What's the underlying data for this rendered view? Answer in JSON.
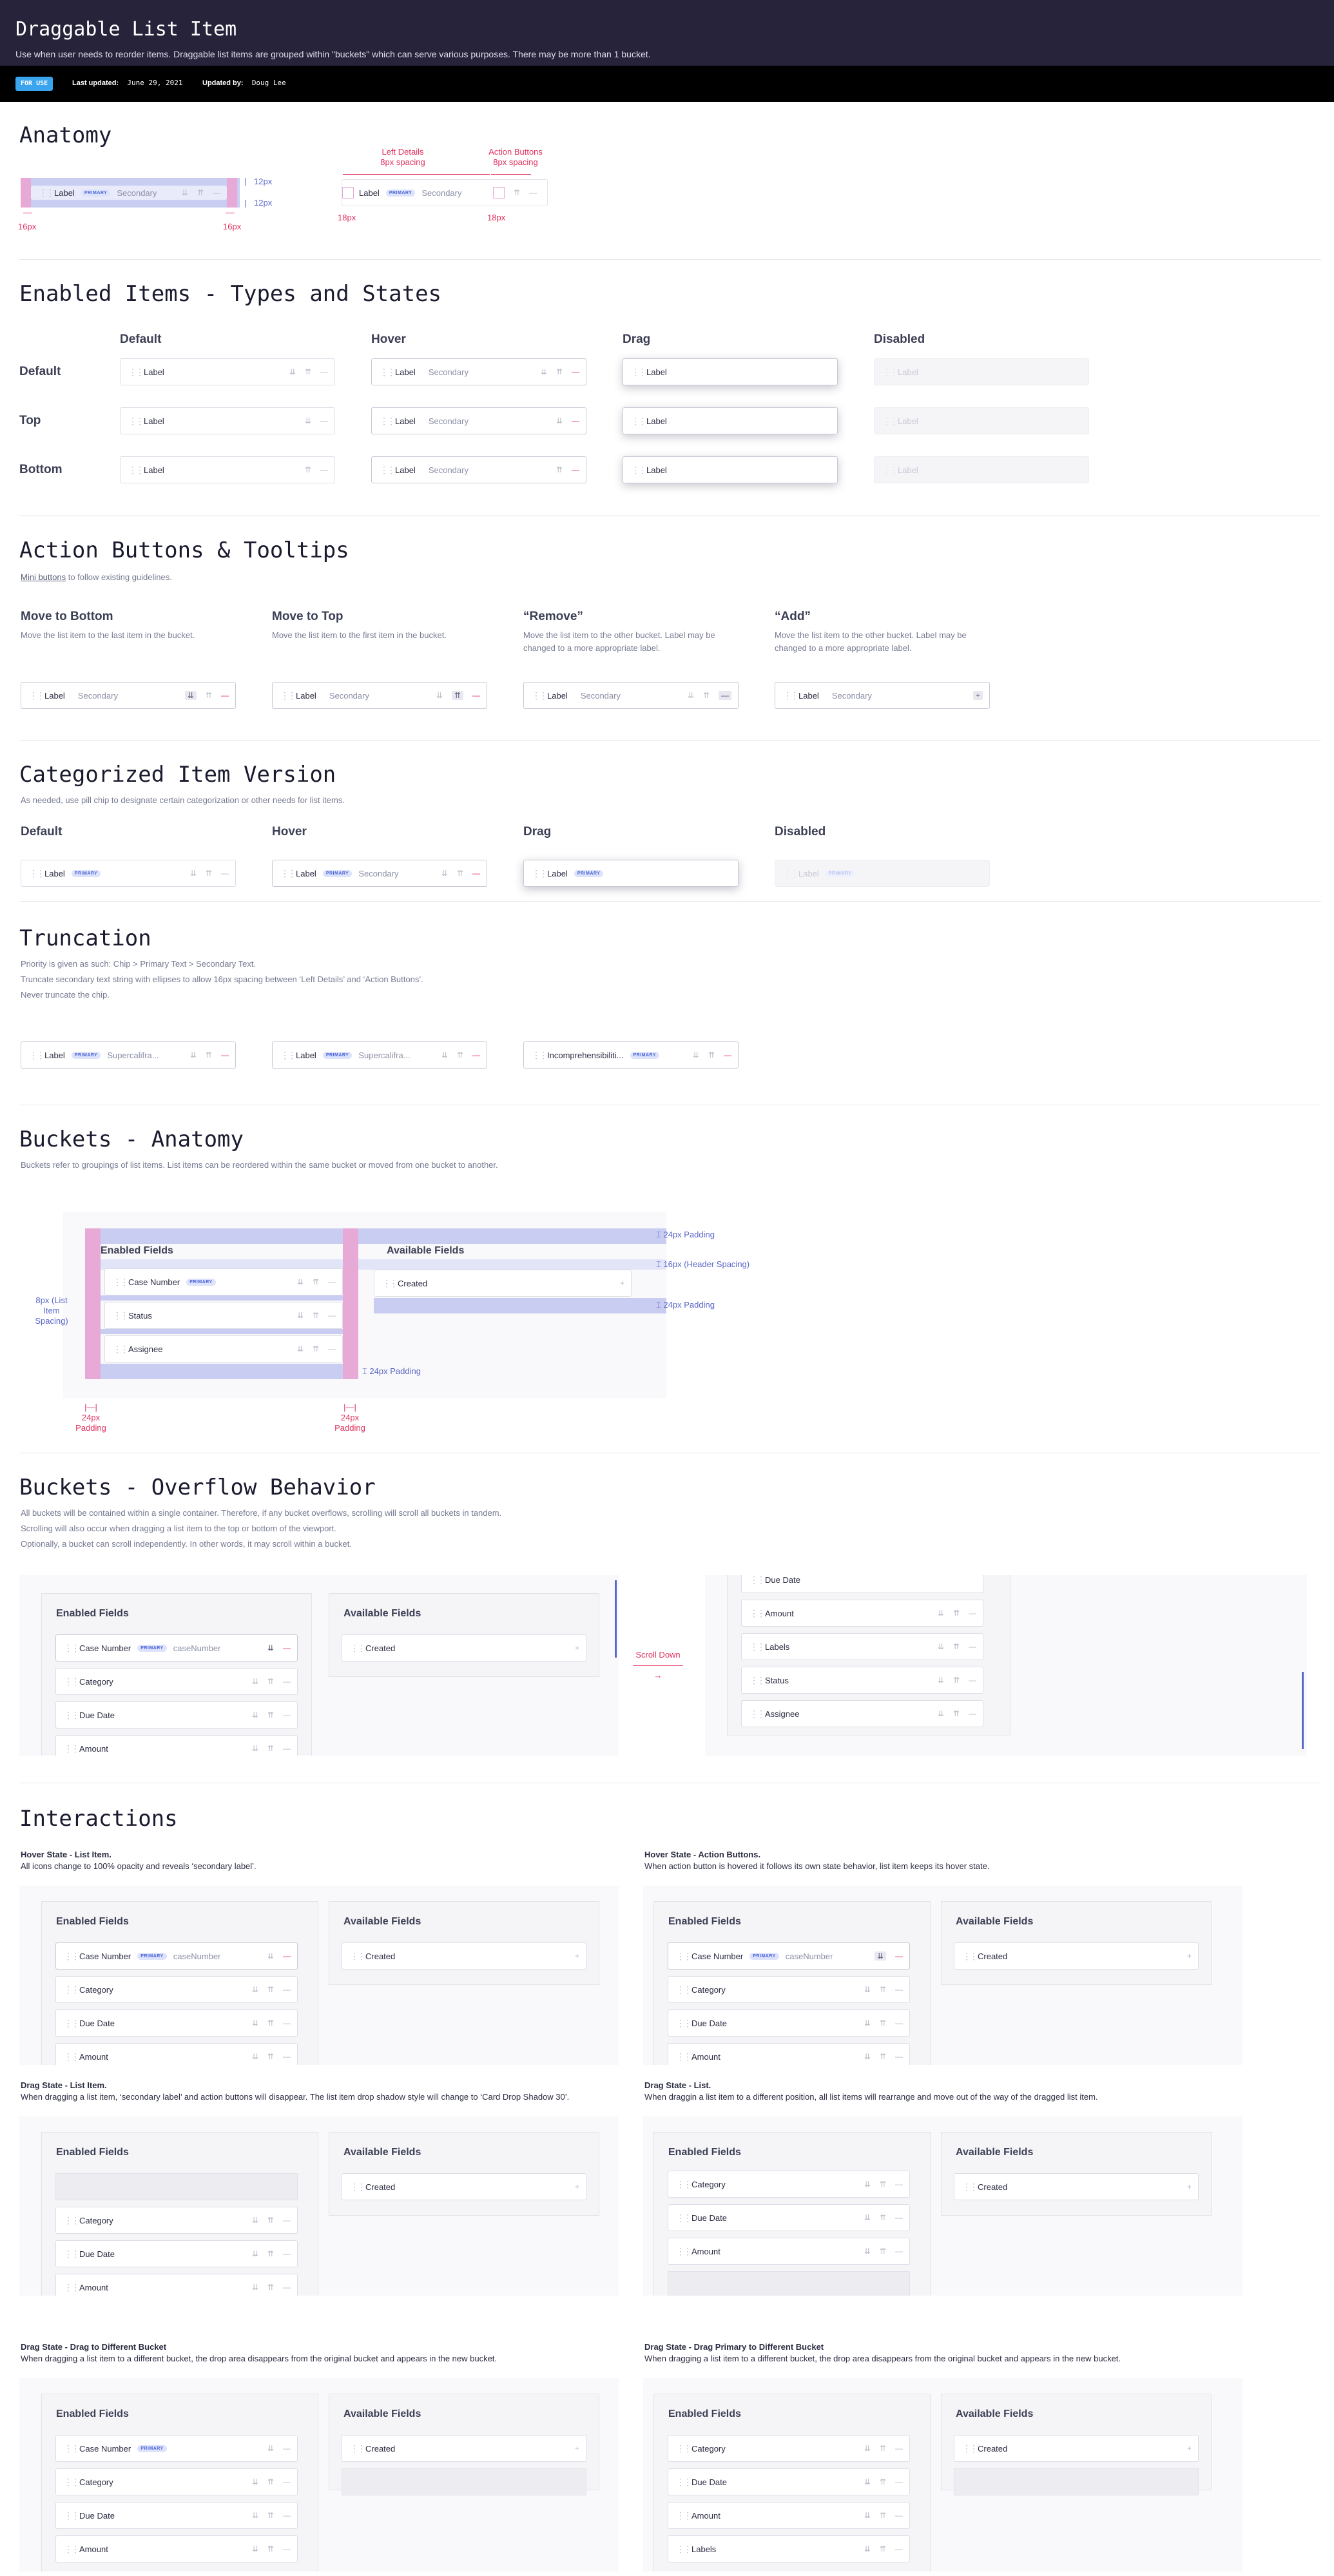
{
  "header": {
    "title": "Draggable List Item",
    "subtitle": "Use when user needs to reorder items. Draggable list items are grouped within \"buckets\" which can serve various purposes. There may be more than 1 bucket.",
    "tag": "FOR USE",
    "updated_label": "Last updated:",
    "updated_value": "June 29, 2021",
    "by_label": "Updated by:",
    "by_value": "Doug Lee"
  },
  "anatomy": {
    "title": "Anatomy",
    "label": "Label",
    "chip": "PRIMARY",
    "secondary": "Secondary",
    "m1": "16px",
    "m2": "16px",
    "h1": "12px",
    "h2": "12px",
    "left_details": "Left Details",
    "left_spacing": "8px spacing",
    "action_buttons": "Action Buttons",
    "action_spacing": "8px spacing",
    "b1": "18px",
    "b2": "18px"
  },
  "enabled": {
    "title": "Enabled Items - Types and States",
    "cols": [
      "Default",
      "Hover",
      "Drag",
      "Disabled"
    ],
    "rows": [
      "Default",
      "Top",
      "Bottom"
    ],
    "label": "Label",
    "secondary": "Secondary"
  },
  "actions": {
    "title": "Action Buttons & Tooltips",
    "note_link": "Mini buttons",
    "note_rest": " to follow existing guidelines.",
    "items": [
      {
        "title": "Move to Bottom",
        "desc": "Move the list item to the last item in the bucket."
      },
      {
        "title": "Move to Top",
        "desc": "Move the list item to the first item in the bucket."
      },
      {
        "title": "“Remove”",
        "desc": "Move the list item to the other bucket. Label may be changed to a more appropriate label."
      },
      {
        "title": "“Add”",
        "desc": "Move the list item to the other bucket. Label may be changed to a more appropriate label."
      }
    ],
    "label": "Label",
    "secondary": "Secondary"
  },
  "categorized": {
    "title": "Categorized Item Version",
    "desc": "As needed, use pill chip to designate certain categorization or other needs for list items.",
    "cols": [
      "Default",
      "Hover",
      "Drag",
      "Disabled"
    ],
    "label": "Label",
    "chip": "PRIMARY",
    "secondary": "Secondary"
  },
  "truncation": {
    "title": "Truncation",
    "lines": [
      "Priority is given as such: Chip > Primary Text > Secondary Text.",
      "Truncate secondary text string with ellipses to allow 16px spacing between ‘Left Details’ and ‘Action Buttons’.",
      "Never truncate the chip."
    ],
    "label": "Label",
    "chip": "PRIMARY",
    "trunc": "Supercalifra...",
    "long": "Incomprehensibiliti..."
  },
  "bucketsAnatomy": {
    "title": "Buckets - Anatomy",
    "desc": "Buckets refer to groupings of list items. List items can be reordered within the same bucket or moved from one bucket to another.",
    "enabled": "Enabled Fields",
    "available": "Available Fields",
    "items": [
      "Case Number",
      "Status",
      "Assignee"
    ],
    "chip": "PRIMARY",
    "created": "Created",
    "pad1": "24px Padding",
    "header_spacing": "16px (Header Spacing)",
    "pad2": "24px Padding",
    "pad3": "24px Padding",
    "list_spacing": "8px (List Item Spacing)",
    "p24a": "24px",
    "p24b": "Padding",
    "p24c": "24px",
    "p24d": "Padding"
  },
  "overflow": {
    "title": "Buckets - Overflow Behavior",
    "lines": [
      "All buckets will be contained within a single container. Therefore, if any bucket overflows, scrolling will scroll all buckets in tandem.",
      "Scrolling will also occur when dragging a list item to the top or bottom of the viewport.",
      "Optionally, a bucket can scroll independently. In other words, it may scroll within a bucket."
    ],
    "enabled": "Enabled Fields",
    "available": "Available Fields",
    "chip": "PRIMARY",
    "case_number": "Case Number",
    "case_sec": "caseNumber",
    "items": [
      "Category",
      "Due Date",
      "Amount"
    ],
    "created": "Created",
    "scroll": "Scroll Down",
    "right_items": [
      "Due Date",
      "Amount",
      "Labels",
      "Status",
      "Assignee"
    ]
  },
  "interactions": {
    "title": "Interactions",
    "blocks": [
      {
        "t": "Hover State - List Item.",
        "d": "All icons change to 100% opacity and reveals ‘secondary label’."
      },
      {
        "t": "Hover State - Action Buttons.",
        "d": "When action button is hovered it follows its own state behavior, list item keeps its hover state."
      },
      {
        "t": "Drag State - List Item.",
        "d": "When dragging a list item, ‘secondary label’ and action buttons will disappear. The list item drop shadow style will change to  ‘Card Drop Shadow 30’."
      },
      {
        "t": "Drag State - List.",
        "d": "When draggin a list item to a different position, all list items will rearrange and move out of the way of the dragged list item."
      },
      {
        "t": "Drag State - Drag to Different Bucket",
        "d": "When dragging a list item to a different bucket, the drop area disappears from the original bucket and appears in the new bucket."
      },
      {
        "t": "Drag State - Drag Primary to Different Bucket",
        "d": "When dragging a list item to a different bucket, the drop area disappears from the original bucket and appears in the new bucket."
      }
    ],
    "enabled": "Enabled Fields",
    "available": "Available Fields",
    "case_number": "Case Number",
    "chip": "PRIMARY",
    "case_sec": "caseNumber",
    "category": "Category",
    "due_date": "Due Date",
    "amount": "Amount",
    "labels": "Labels",
    "created": "Created"
  }
}
